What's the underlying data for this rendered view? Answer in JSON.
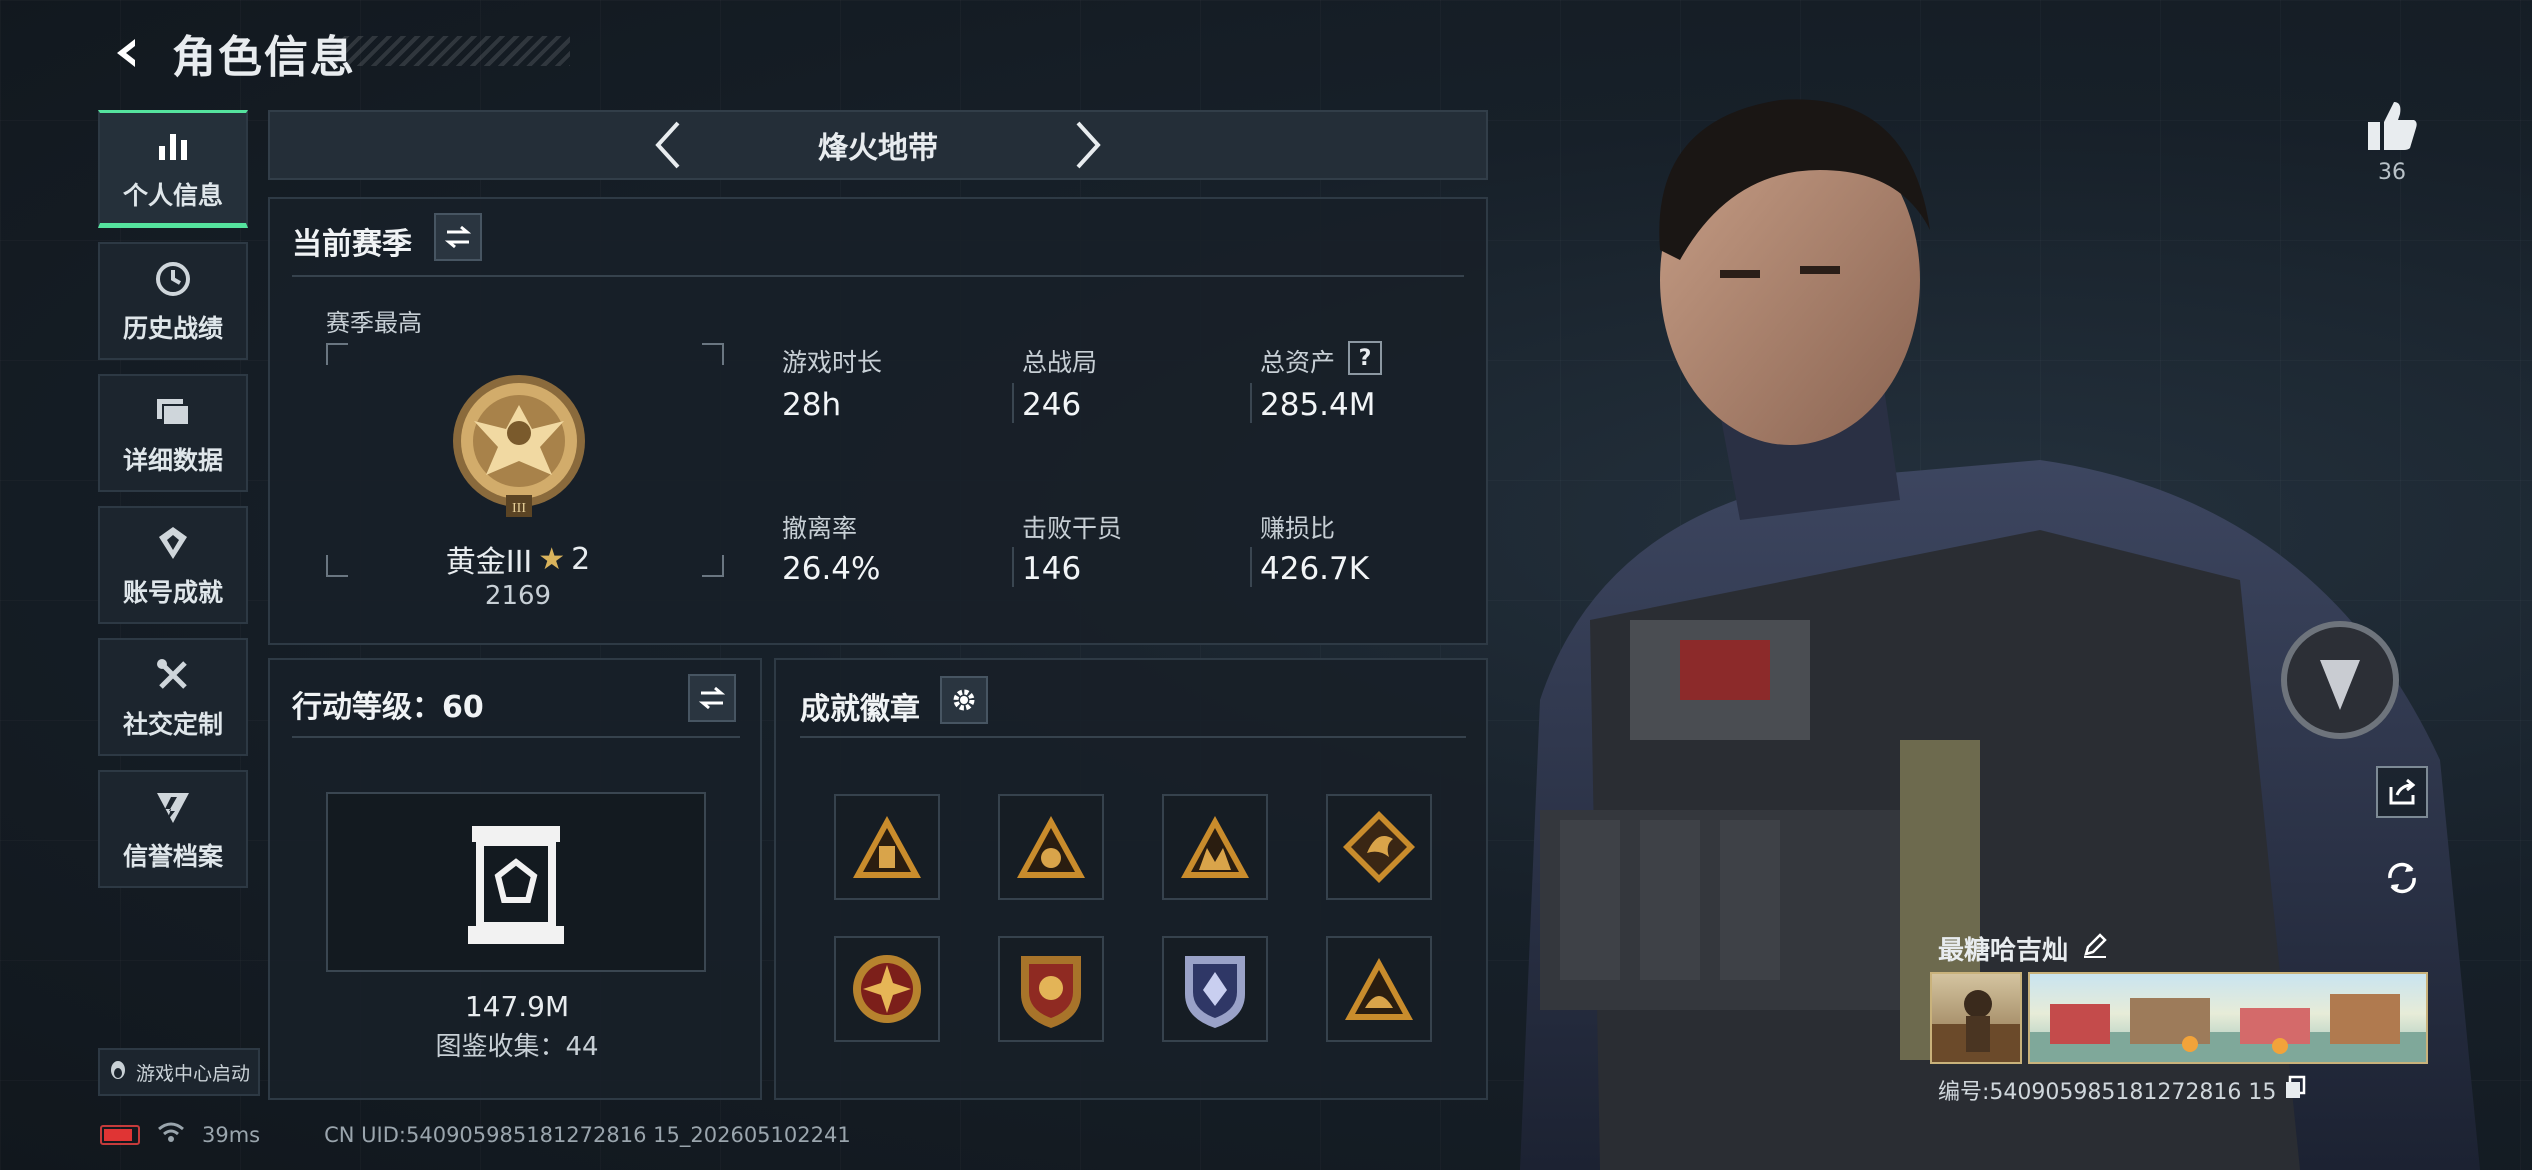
{
  "header": {
    "title": "角色信息"
  },
  "sidebar": {
    "items": [
      {
        "label": "个人信息",
        "icon": "bar-chart-icon",
        "active": true
      },
      {
        "label": "历史战绩",
        "icon": "history-icon"
      },
      {
        "label": "详细数据",
        "icon": "folders-icon"
      },
      {
        "label": "账号成就",
        "icon": "achievement-icon"
      },
      {
        "label": "社交定制",
        "icon": "tools-icon"
      },
      {
        "label": "信誉档案",
        "icon": "credit-icon"
      }
    ],
    "launcher_label": "游戏中心启动"
  },
  "mode": {
    "name": "烽火地带"
  },
  "season": {
    "title": "当前赛季",
    "best_label": "赛季最高",
    "rank_name": "黄金III",
    "rank_stars": "2",
    "rank_score": "2169",
    "stats": [
      {
        "label": "游戏时长",
        "value": "28h"
      },
      {
        "label": "总战局",
        "value": "246"
      },
      {
        "label": "总资产",
        "value": "285.4M",
        "help": "?"
      },
      {
        "label": "撤离率",
        "value": "26.4%"
      },
      {
        "label": "击败干员",
        "value": "146"
      },
      {
        "label": "赚损比",
        "value": "426.7K"
      }
    ]
  },
  "action_level": {
    "title": "行动等级：60",
    "collection_value": "147.9M",
    "collection_label": "图鉴收集：44"
  },
  "badges": {
    "title": "成就徽章",
    "items": [
      "badge-1",
      "badge-2",
      "badge-3",
      "badge-4",
      "badge-5",
      "badge-6",
      "badge-7",
      "badge-8"
    ]
  },
  "profile": {
    "likes": "36",
    "player_name": "最糖哈吉灿",
    "player_id": "编号:540905985181272816 15"
  },
  "status": {
    "ping": "39ms",
    "uid": "CN UID:540905985181272816 15_202605102241"
  },
  "colors": {
    "accent": "#55e39e",
    "gold": "#c9a35a",
    "battery": "#e03434"
  }
}
